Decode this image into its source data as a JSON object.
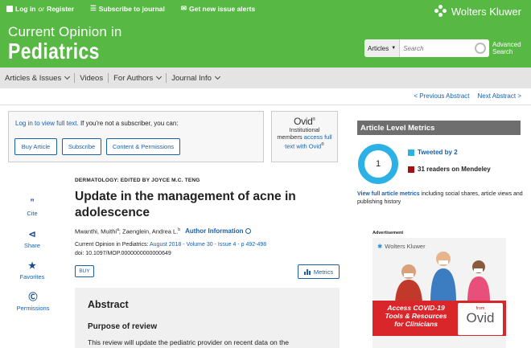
{
  "header": {
    "links": {
      "login": "Log in",
      "or": "or",
      "register": "Register",
      "subscribe": "Subscribe to journal",
      "alerts": "Get new issue alerts"
    },
    "publisher": "Wolters Kluwer",
    "journal_line1": "Current Opinion in",
    "journal_line2": "Pediatrics",
    "search_scope": "Articles",
    "search_placeholder": "Search",
    "advanced_search_line1": "Advanced",
    "advanced_search_line2": "Search"
  },
  "nav": {
    "items": [
      "Articles & Issues",
      "Videos",
      "For Authors",
      "Journal Info"
    ]
  },
  "pager": {
    "prev": "< Previous Abstract",
    "next": "Next Abstract >"
  },
  "access": {
    "login_link": "Log in to view full text.",
    "login_rest": " If you're not a subscriber, you can:",
    "buttons": [
      "Buy Article",
      "Subscribe",
      "Content & Permissions"
    ],
    "ovid_logo": "Ovid",
    "ovid_text1": "Institutional",
    "ovid_text2": "members",
    "ovid_link": "access full text with Ovid",
    "ovid_reg": "®"
  },
  "tools": [
    {
      "icon": "quote-icon",
      "glyph": "”",
      "label": "Cite"
    },
    {
      "icon": "share-icon",
      "glyph": "⊲",
      "label": "Share"
    },
    {
      "icon": "star-icon",
      "glyph": "★",
      "label": "Favorites"
    },
    {
      "icon": "copyright-icon",
      "glyph": "Ⓒ",
      "label": "Permissions"
    }
  ],
  "article": {
    "category": "DERMATOLOGY: EDITED BY JOYCE M.C. TENG",
    "title": "Update in the management of acne in adolescence",
    "authors": "Mwanthi, Muithi",
    "authors_sup1": "a",
    "authors_rest": "; Zaenglein, Andrea L.",
    "authors_sup2": "b",
    "author_info": "Author Information",
    "journal": "Current Opinion in Pediatrics: ",
    "journal_link": "August 2018 - Volume 30 - Issue 4 - p 492-498",
    "doi": "doi: 10.1097/MOP.0000000000000649",
    "buy": "BUY",
    "metrics": "Metrics",
    "abstract_heading": "Abstract",
    "purpose_heading": "Purpose of review",
    "abstract_text": "This review will update the pediatric provider on recent data on the"
  },
  "metrics_panel": {
    "heading": "Article Level Metrics",
    "altmetric_score": "1",
    "tweeted": "Tweeted by 2",
    "mendeley": "31 readers on Mendeley",
    "full_link": "View full article metrics",
    "full_rest": " including social shares, article views and publishing history",
    "colors": {
      "tweet": "#2bb1e5",
      "mendeley": "#a50f15"
    }
  },
  "ad": {
    "label": "Advertisement",
    "brand": "Wolters Kluwer",
    "line1": "Access COVID-19",
    "line2": "Tools & Resources",
    "line3": "for Clinicians",
    "from": "from",
    "ovid": "Ovid"
  },
  "colors": {
    "header_green": "#57b844",
    "link_blue": "#1a5fa8"
  }
}
